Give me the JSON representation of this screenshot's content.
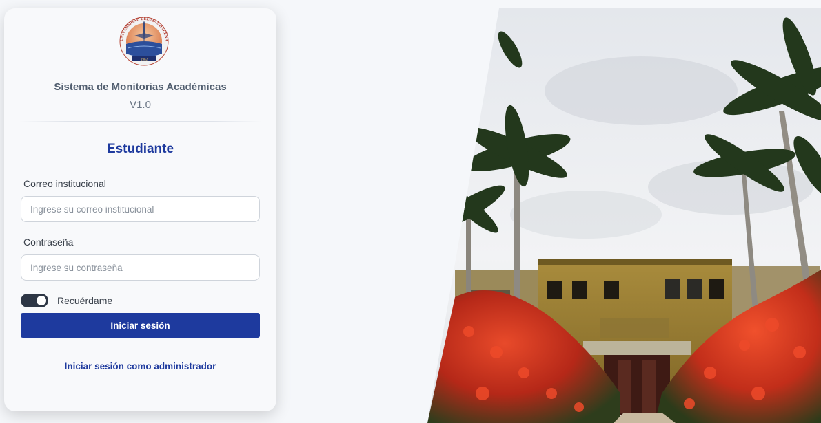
{
  "app": {
    "system_title": "Sistema de Monitorias Académicas",
    "version": "V1.0",
    "logo_text": "UNIVERSIDAD DEL MAGDALENA"
  },
  "login": {
    "role_title": "Estudiante",
    "email_label": "Correo institucional",
    "email_placeholder": "Ingrese su correo institucional",
    "password_label": "Contraseña",
    "password_placeholder": "Ingrese su contraseña",
    "remember_label": "Recuérdame",
    "remember_checked": true,
    "submit_label": "Iniciar sesión",
    "admin_link": "Iniciar sesión como administrador"
  },
  "colors": {
    "primary": "#1e3a9e",
    "toggle_bg": "#2d3645",
    "card_bg": "#f8f9fb",
    "page_bg": "#f5f7fa"
  },
  "photo": {
    "description_icon": "campus-building-photo"
  }
}
